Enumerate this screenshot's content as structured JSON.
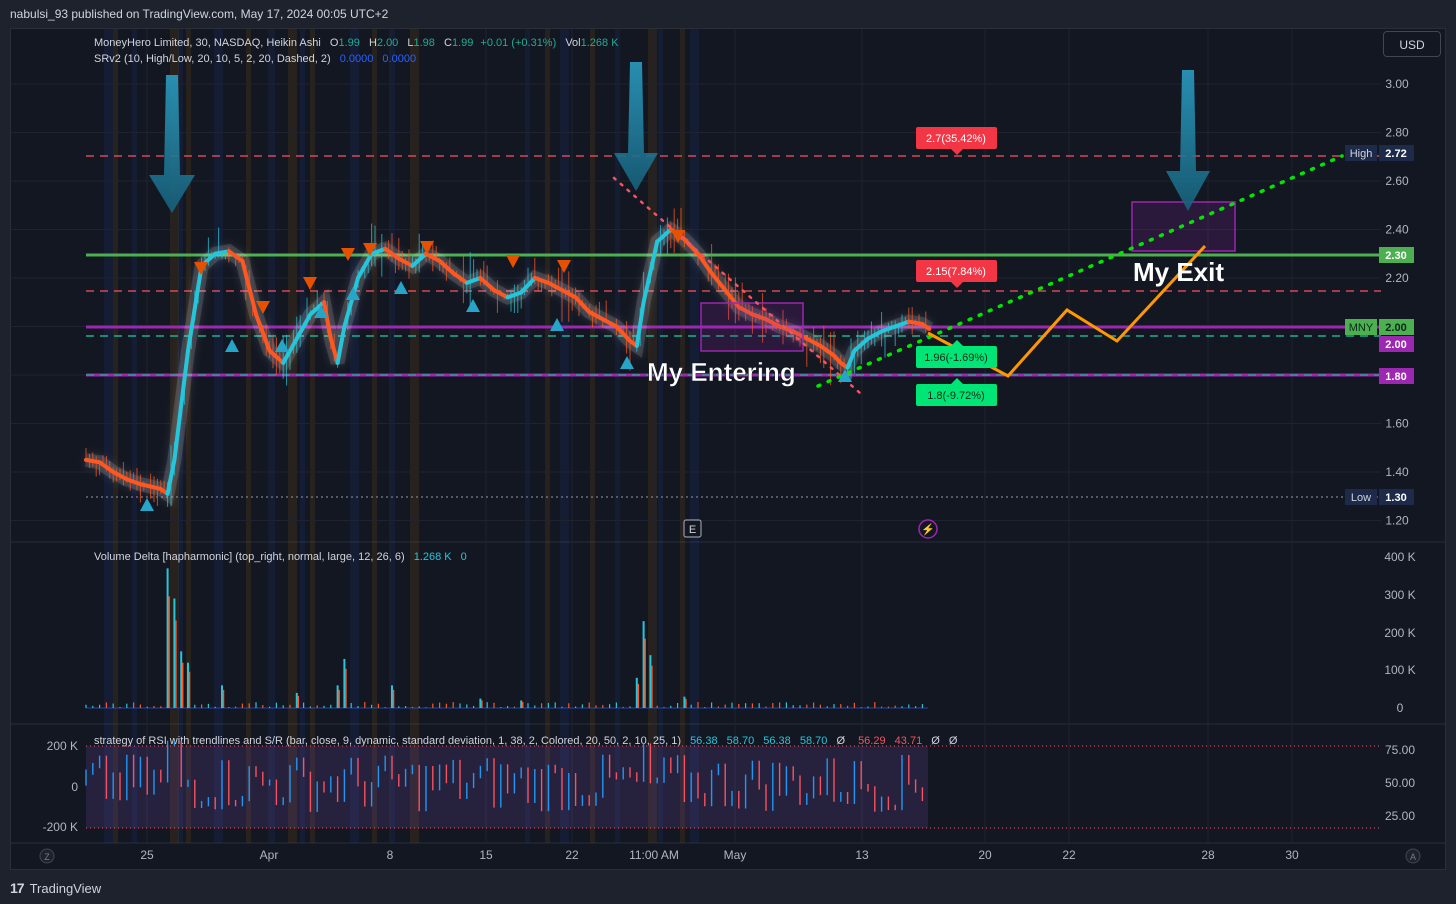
{
  "publisher": "nabulsi_93 published on TradingView.com, May 17, 2024 00:05 UTC+2",
  "currency": "USD",
  "brand": "TradingView",
  "brand_logo": "17",
  "legend": {
    "symbol": "MoneyHero Limited, 30, NASDAQ, Heikin Ashi",
    "o_label": "O",
    "o": "1.99",
    "h_label": "H",
    "h": "2.00",
    "l_label": "L",
    "l": "1.98",
    "c_label": "C",
    "c": "1.99",
    "change": "+0.01 (+0.31%)",
    "vol_label": "Vol",
    "vol": "1.268 K",
    "srv2": "SRv2 (10, High/Low, 20, 10, 5, 2, 20, Dashed, 2)",
    "srv2_v1": "0.0000",
    "srv2_v2": "0.0000",
    "vd": "Volume Delta [hapharmonic] (top_right, normal, large, 12, 26, 6)",
    "vd_v1": "1.268 K",
    "vd_v2": "0",
    "rsi": "strategy of RSI with trendlines and S/R (bar, close, 9, dynamic, standard deviation, 1, 38, 2, Colored, 20,   50, 2, 10,   25, 1)",
    "rsi_vals": [
      "56.38",
      "58.70",
      "56.38",
      "58.70",
      "Ø"
    ],
    "rsi_vals2": [
      "56.29",
      "43.71",
      "Ø",
      "Ø"
    ]
  },
  "annotations": {
    "entering": "My Entering",
    "exit": "My Exit",
    "tp1": "2.7(35.42%)",
    "tp2": "2.15(7.84%)",
    "sl1": "1.96(-1.69%)",
    "sl2": "1.8(-9.72%)",
    "events_e": "E",
    "events_flash": "⚡"
  },
  "price_tags": {
    "high_label": "High",
    "high": "2.72",
    "t230": "2.30",
    "mny_label": "MNY",
    "mny": "2.00",
    "t200": "2.00",
    "t180": "1.80",
    "low_label": "Low",
    "low": "1.30"
  },
  "bottom_corners": {
    "left": "Z",
    "right": "A"
  },
  "colors": {
    "bull": "#26c6da",
    "bear": "#ff5722",
    "green_level": "#4caf50",
    "purple_level": "#9c27b0",
    "red_dash": "#f7525f",
    "green_dash": "#22ab94",
    "arrow": "#1b7fa0",
    "path": "#ff9800",
    "dots": "#00e600"
  },
  "chart_data": [
    {
      "type": "line",
      "title": "MoneyHero Limited, 30, NASDAQ, Heikin Ashi",
      "yticks": [
        "3.00",
        "2.80",
        "2.60",
        "2.40",
        "2.20",
        "2.00",
        "1.80",
        "1.60",
        "1.40",
        "1.20"
      ],
      "ylim": [
        1.15,
        3.1
      ],
      "xticks": [
        "25",
        "Apr",
        "8",
        "15",
        "22",
        "11:00 AM",
        "May",
        "13",
        "20",
        "22",
        "28",
        "30"
      ],
      "price_path": [
        [
          0,
          1.45
        ],
        [
          2,
          1.44
        ],
        [
          4,
          1.4
        ],
        [
          6,
          1.37
        ],
        [
          8,
          1.35
        ],
        [
          11,
          1.33
        ],
        [
          12,
          1.31
        ],
        [
          13,
          1.45
        ],
        [
          15,
          1.9
        ],
        [
          17,
          2.25
        ],
        [
          19,
          2.3
        ],
        [
          21,
          2.31
        ],
        [
          23,
          2.27
        ],
        [
          25,
          2.05
        ],
        [
          27,
          1.9
        ],
        [
          29,
          1.85
        ],
        [
          31,
          1.95
        ],
        [
          33,
          2.05
        ],
        [
          35,
          2.1
        ],
        [
          36,
          1.95
        ],
        [
          37,
          1.85
        ],
        [
          38,
          2.0
        ],
        [
          40,
          2.2
        ],
        [
          42,
          2.3
        ],
        [
          44,
          2.32
        ],
        [
          46,
          2.28
        ],
        [
          48,
          2.25
        ],
        [
          50,
          2.3
        ],
        [
          52,
          2.27
        ],
        [
          54,
          2.22
        ],
        [
          56,
          2.18
        ],
        [
          58,
          2.2
        ],
        [
          60,
          2.15
        ],
        [
          62,
          2.12
        ],
        [
          64,
          2.14
        ],
        [
          66,
          2.2
        ],
        [
          68,
          2.18
        ],
        [
          70,
          2.15
        ],
        [
          72,
          2.12
        ],
        [
          74,
          2.06
        ],
        [
          76,
          2.03
        ],
        [
          78,
          2.0
        ],
        [
          80,
          1.94
        ],
        [
          81,
          1.92
        ],
        [
          82,
          2.1
        ],
        [
          84,
          2.35
        ],
        [
          86,
          2.4
        ],
        [
          88,
          2.36
        ],
        [
          90,
          2.3
        ],
        [
          92,
          2.22
        ],
        [
          94,
          2.15
        ],
        [
          96,
          2.08
        ],
        [
          98,
          2.05
        ],
        [
          100,
          2.03
        ],
        [
          102,
          2.0
        ],
        [
          104,
          1.98
        ],
        [
          106,
          1.95
        ],
        [
          108,
          1.92
        ],
        [
          110,
          1.88
        ],
        [
          111,
          1.85
        ],
        [
          112,
          1.83
        ],
        [
          113,
          1.9
        ],
        [
          115,
          1.95
        ],
        [
          117,
          1.98
        ],
        [
          119,
          2.0
        ],
        [
          121,
          2.02
        ],
        [
          123,
          2.01
        ],
        [
          124,
          1.99
        ]
      ],
      "levels": {
        "high": 2.72,
        "green": 2.3,
        "red_dash_1": 2.72,
        "red_dash_2": 2.15,
        "purple": 2.015,
        "green_dash": 1.97,
        "purple_low": 1.8,
        "low": 1.3
      }
    },
    {
      "type": "bar",
      "title": "Volume Delta [hapharmonic] (top_right, normal, large, 12, 26, 6)",
      "yticks": [
        "400 K",
        "300 K",
        "200 K",
        "100 K",
        "0"
      ],
      "ylim": [
        0,
        400000
      ],
      "spikes": [
        {
          "x": 12,
          "value": 370000
        },
        {
          "x": 13,
          "value": 290000
        },
        {
          "x": 14,
          "value": 150000
        },
        {
          "x": 15,
          "value": 120000
        },
        {
          "x": 20,
          "value": 60000
        },
        {
          "x": 31,
          "value": 40000
        },
        {
          "x": 37,
          "value": 60000
        },
        {
          "x": 38,
          "value": 130000
        },
        {
          "x": 45,
          "value": 60000
        },
        {
          "x": 58,
          "value": 25000
        },
        {
          "x": 64,
          "value": 20000
        },
        {
          "x": 81,
          "value": 80000
        },
        {
          "x": 82,
          "value": 230000
        },
        {
          "x": 83,
          "value": 140000
        },
        {
          "x": 88,
          "value": 30000
        }
      ]
    },
    {
      "type": "line",
      "title": "strategy of RSI with trendlines and S/R",
      "yticks_right": [
        "75.00",
        "50.00",
        "25.00"
      ],
      "yticks_left": [
        "200 K",
        "0",
        "-200 K"
      ],
      "ylim": [
        20,
        80
      ]
    }
  ]
}
